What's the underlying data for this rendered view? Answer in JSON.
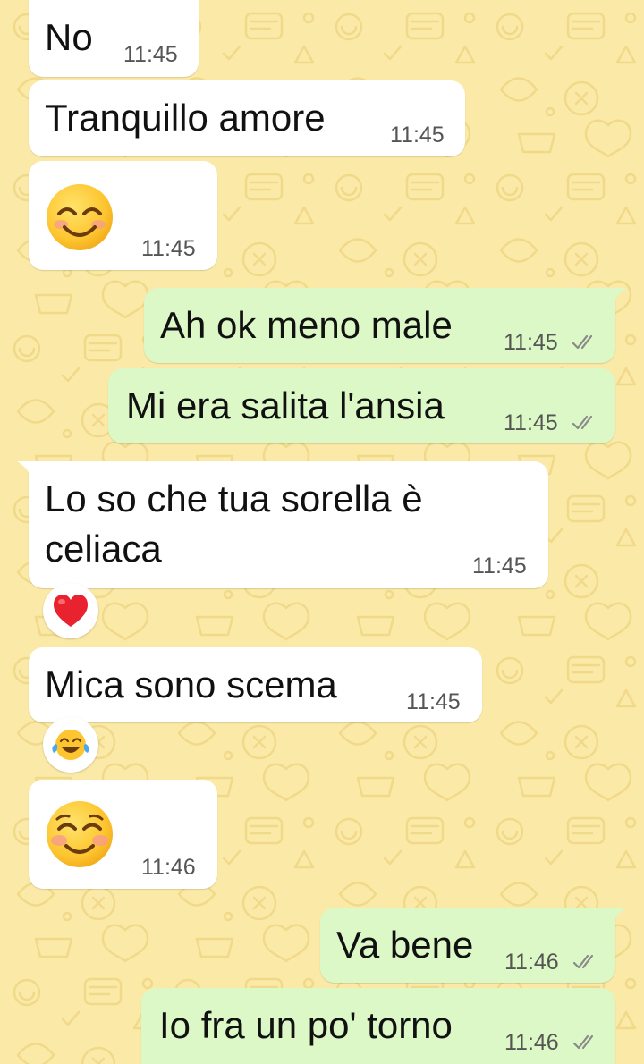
{
  "chat": {
    "colors": {
      "wallpaper": "#fbe9a7",
      "incoming_bubble": "#ffffff",
      "outgoing_bubble": "#dcf8c6",
      "read_ticks": "#8a8a8a"
    },
    "messages": [
      {
        "direction": "in",
        "text": "No",
        "time": "11:45"
      },
      {
        "direction": "in",
        "text": "Tranquillo amore",
        "time": "11:45"
      },
      {
        "direction": "in",
        "emoji": "smiling-face-with-smiling-eyes",
        "time": "11:45"
      },
      {
        "direction": "out",
        "text": "Ah ok meno male",
        "time": "11:45",
        "status": "read"
      },
      {
        "direction": "out",
        "text": "Mi era salita l'ansia",
        "time": "11:45",
        "status": "read"
      },
      {
        "direction": "in",
        "text": "Lo so che tua sorella è celiaca",
        "time": "11:45",
        "reaction": "red-heart"
      },
      {
        "direction": "in",
        "text": "Mica sono scema",
        "time": "11:45",
        "reaction": "face-with-tears-of-joy"
      },
      {
        "direction": "in",
        "emoji": "smiling-face",
        "time": "11:46"
      },
      {
        "direction": "out",
        "text": "Va bene",
        "time": "11:46",
        "status": "read"
      },
      {
        "direction": "out",
        "text": "Io fra un po' torno",
        "time": "11:46",
        "status": "read"
      }
    ]
  }
}
